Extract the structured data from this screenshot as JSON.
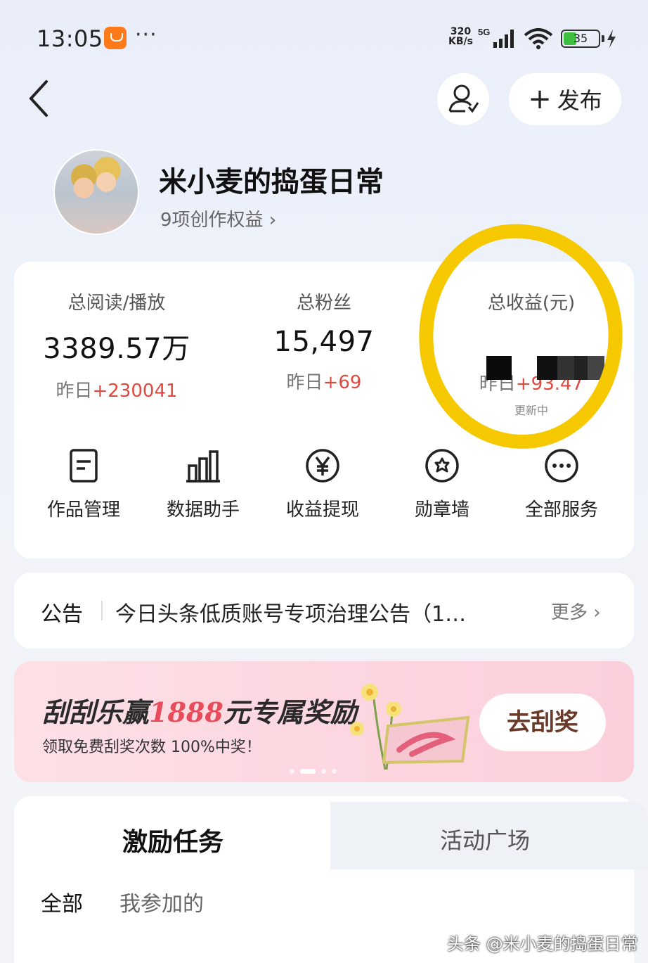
{
  "status_bar": {
    "time": "13:05",
    "net_speed_value": "320",
    "net_speed_unit": "KB/s",
    "network": "5G",
    "battery": "35",
    "more": "···"
  },
  "header": {
    "publish_label": "发布"
  },
  "profile": {
    "name": "米小麦的捣蛋日常",
    "benefits": "9项创作权益 ›"
  },
  "stats": [
    {
      "label": "总阅读/播放",
      "value": "3389.57万",
      "delta_prefix": "昨日",
      "delta": "+230041"
    },
    {
      "label": "总粉丝",
      "value": "15,497",
      "delta_prefix": "昨日",
      "delta": "+69"
    },
    {
      "label": "总收益(元)",
      "value": "",
      "delta_prefix": "昨日",
      "delta": "+93.47",
      "note": "更新中"
    }
  ],
  "services": [
    {
      "label": "作品管理",
      "icon": "document-icon"
    },
    {
      "label": "数据助手",
      "icon": "bar-chart-icon"
    },
    {
      "label": "收益提现",
      "icon": "yuan-icon"
    },
    {
      "label": "勋章墙",
      "icon": "medal-icon"
    },
    {
      "label": "全部服务",
      "icon": "more-icon"
    }
  ],
  "notice": {
    "title": "公告",
    "text": "今日头条低质账号专项治理公告（1…",
    "more": "更多 ›"
  },
  "banner": {
    "title_prefix": "刮刮乐赢",
    "title_amount": "1888",
    "title_suffix": "元专属奖励",
    "subtitle": "领取免费刮奖次数 100%中奖！",
    "button": "去刮奖"
  },
  "tasks": {
    "tab_active": "激励任务",
    "tab_inactive": "活动广场",
    "filter_all": "全部",
    "filter_mine": "我参加的"
  },
  "watermark": "头条 @米小麦的捣蛋日常",
  "colors": {
    "accent_red": "#e0493f",
    "highlight": "#f5c800",
    "banner_bg": "#fcd5df"
  }
}
